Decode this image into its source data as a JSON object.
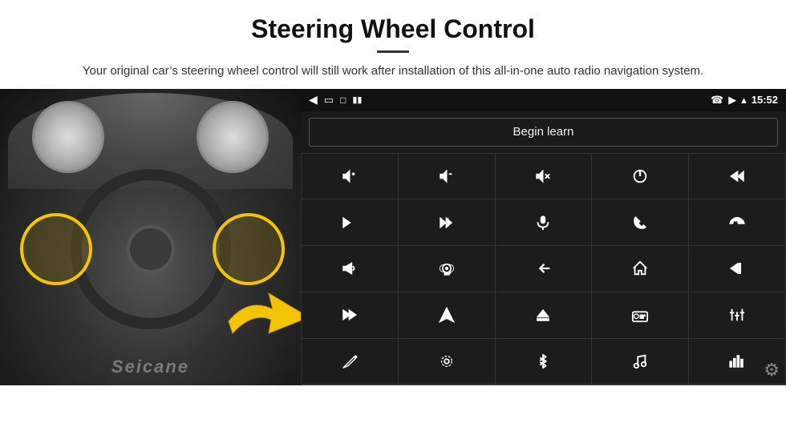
{
  "header": {
    "title": "Steering Wheel Control",
    "subtitle": "Your original car’s steering wheel control will still work after installation of this all-in-one auto radio navigation system."
  },
  "status_bar": {
    "left_icons": [
      "back-arrow",
      "window-icon",
      "square-icon",
      "battery-icon"
    ],
    "time": "15:52",
    "right_icons": [
      "phone-icon",
      "location-icon",
      "wifi-icon"
    ]
  },
  "begin_learn_button": "Begin learn",
  "controls": [
    {
      "id": "vol-up",
      "icon": "vol-up"
    },
    {
      "id": "vol-down",
      "icon": "vol-down"
    },
    {
      "id": "mute",
      "icon": "mute"
    },
    {
      "id": "power",
      "icon": "power"
    },
    {
      "id": "prev-track",
      "icon": "prev-track"
    },
    {
      "id": "next-track",
      "icon": "next-track"
    },
    {
      "id": "fast-forward",
      "icon": "fast-forward"
    },
    {
      "id": "mic",
      "icon": "mic"
    },
    {
      "id": "phone",
      "icon": "phone"
    },
    {
      "id": "hang-up",
      "icon": "hang-up"
    },
    {
      "id": "horn",
      "icon": "horn"
    },
    {
      "id": "360-cam",
      "icon": "360-cam"
    },
    {
      "id": "back",
      "icon": "back"
    },
    {
      "id": "home",
      "icon": "home"
    },
    {
      "id": "rewind",
      "icon": "rewind"
    },
    {
      "id": "skip-next",
      "icon": "skip-next"
    },
    {
      "id": "nav",
      "icon": "nav"
    },
    {
      "id": "eject",
      "icon": "eject"
    },
    {
      "id": "radio",
      "icon": "radio"
    },
    {
      "id": "equalizer",
      "icon": "equalizer"
    },
    {
      "id": "pen",
      "icon": "pen"
    },
    {
      "id": "settings2",
      "icon": "settings2"
    },
    {
      "id": "bluetooth",
      "icon": "bluetooth"
    },
    {
      "id": "music",
      "icon": "music"
    },
    {
      "id": "levels",
      "icon": "levels"
    }
  ],
  "watermark": "Seicane",
  "gear_label": "Settings"
}
